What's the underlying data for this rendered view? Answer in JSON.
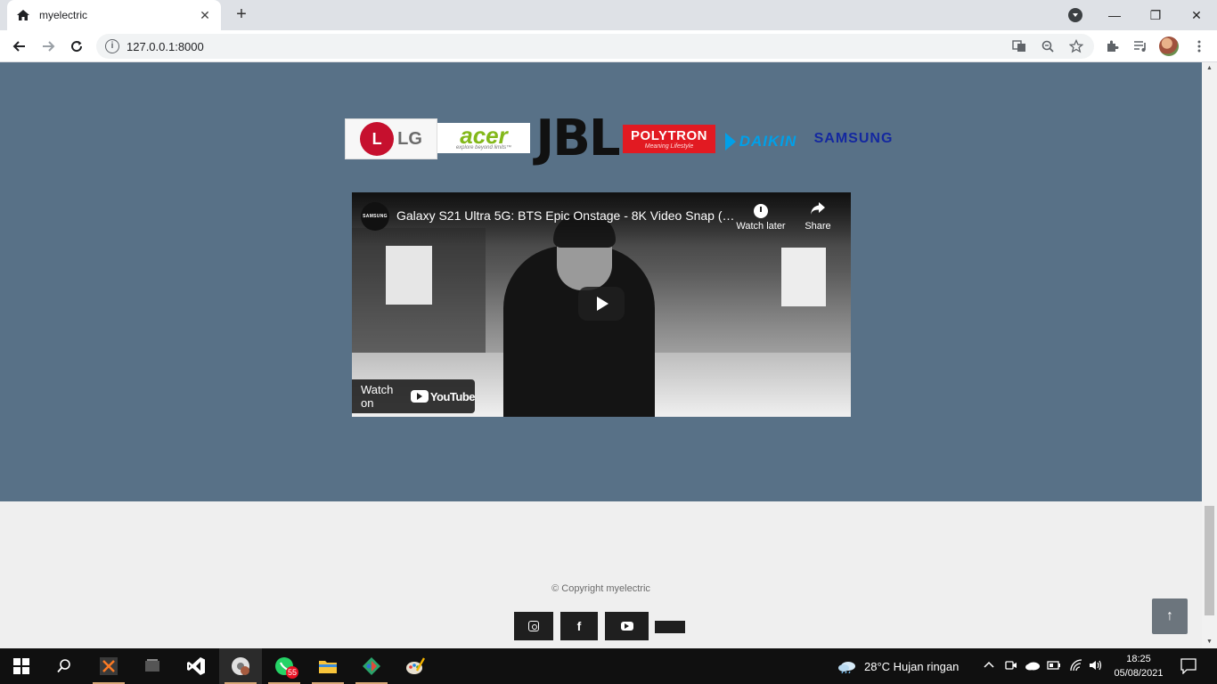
{
  "browser": {
    "tab_title": "myelectric",
    "tab_close": "✕",
    "new_tab": "+",
    "url": "127.0.0.1:8000",
    "window_controls": {
      "minimize": "—",
      "restore": "❐",
      "close": "✕"
    }
  },
  "brands": {
    "lg": {
      "mark": "L",
      "text": "LG"
    },
    "acer": {
      "main": "acer",
      "sub": "explore beyond limits™"
    },
    "jbl": "JBL",
    "polytron": {
      "main": "POLYTRON",
      "sub": "Meaning Lifestyle"
    },
    "daikin": "DAIKIN",
    "samsung": "SAMSUNG"
  },
  "video": {
    "channel": "SAMSUNG",
    "title": "Galaxy S21 Ultra 5G: BTS Epic Onstage - 8K Video Snap (…",
    "watch_later": "Watch later",
    "share": "Share",
    "watch_on": "Watch on",
    "youtube": "YouTube"
  },
  "footer": {
    "copyright": "© Copyright myelectric",
    "facebook": "f",
    "back_to_top": "↑"
  },
  "taskbar": {
    "whatsapp_badge": "55",
    "weather": "28°C  Hujan ringan",
    "time": "18:25",
    "date": "05/08/2021"
  },
  "colors": {
    "brand_section_bg": "#587187",
    "page_bg": "#efefef",
    "social_bg": "#1f1f1f",
    "to_top_bg": "#6c757d"
  }
}
